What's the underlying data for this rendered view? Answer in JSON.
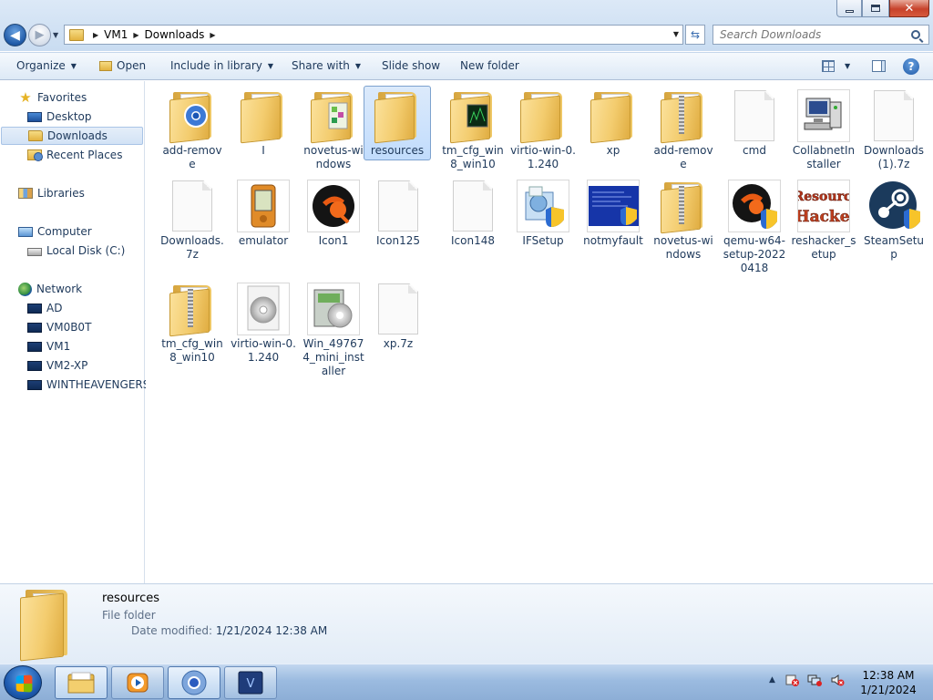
{
  "window": {
    "breadcrumb": [
      "VM1",
      "Downloads"
    ],
    "search_placeholder": "Search Downloads",
    "controls": {
      "minimize": "minimize",
      "maximize": "maximize",
      "close": "close"
    }
  },
  "toolbar": {
    "organize": "Organize",
    "open": "Open",
    "include_in_library": "Include in library",
    "share_with": "Share with",
    "slide_show": "Slide show",
    "new_folder": "New folder"
  },
  "nav": {
    "favorites": "Favorites",
    "desktop": "Desktop",
    "downloads": "Downloads",
    "recent_places": "Recent Places",
    "libraries": "Libraries",
    "computer": "Computer",
    "local_disk": "Local Disk (C:)",
    "network": "Network",
    "hosts": [
      "AD",
      "VM0B0T",
      "VM1",
      "VM2-XP",
      "WINTHEAVENGERS"
    ]
  },
  "files": {
    "row1": [
      {
        "name": "add-remove",
        "type": "folder-chrome"
      },
      {
        "name": "I",
        "type": "folder"
      },
      {
        "name": "novetus-windows",
        "type": "folder-novetus"
      },
      {
        "name": "resources",
        "type": "folder",
        "selected": true
      },
      {
        "name": "tm_cfg_win8_win10",
        "type": "folder-monitor"
      },
      {
        "name": "virtio-win-0.1.240",
        "type": "folder"
      },
      {
        "name": "xp",
        "type": "folder"
      },
      {
        "name": "add-remove",
        "type": "zip"
      },
      {
        "name": "cmd",
        "type": "file"
      },
      {
        "name": "CollabnetInstaller",
        "type": "computer"
      },
      {
        "name": "Downloads (1).7z",
        "type": "file"
      }
    ],
    "row2": [
      {
        "name": "Downloads.7z",
        "type": "file"
      },
      {
        "name": "emulator",
        "type": "pda"
      },
      {
        "name": "Icon1",
        "type": "qemu"
      },
      {
        "name": "Icon125",
        "type": "file"
      },
      {
        "name": "Icon148",
        "type": "file"
      },
      {
        "name": "IFSetup",
        "type": "setup"
      },
      {
        "name": "notmyfault",
        "type": "bsod"
      },
      {
        "name": "novetus-windows",
        "type": "zip"
      },
      {
        "name": "qemu-w64-setup-20220418",
        "type": "qemu-shield"
      },
      {
        "name": "reshacker_setup",
        "type": "reshacker"
      },
      {
        "name": "SteamSetup",
        "type": "steam"
      }
    ],
    "row3": [
      {
        "name": "tm_cfg_win8_win10",
        "type": "zip"
      },
      {
        "name": "virtio-win-0.1.240",
        "type": "disc"
      },
      {
        "name": "Win_497674_mini_installer",
        "type": "installer"
      },
      {
        "name": "xp.7z",
        "type": "file"
      }
    ]
  },
  "reshacker_logo": [
    "Resource",
    "Hacker"
  ],
  "details": {
    "name": "resources",
    "type": "File folder",
    "modified_label": "Date modified:",
    "modified_value": "1/21/2024 12:38 AM"
  },
  "taskbar": {
    "time": "12:38 AM",
    "date": "1/21/2024"
  },
  "colors": {
    "selection": "#c1dcfc",
    "folder": "#f3cc6e",
    "titlebar": "#dce9f7"
  }
}
